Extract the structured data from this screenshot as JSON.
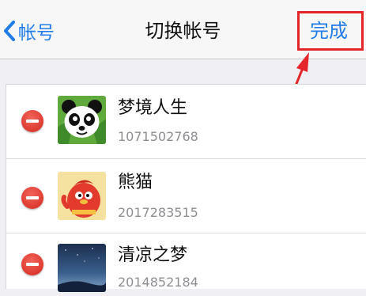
{
  "navbar": {
    "back_label": "帐号",
    "title": "切换帐号",
    "done_label": "完成"
  },
  "accounts": [
    {
      "name": "梦境人生",
      "id": "1071502768",
      "avatar": "panda-avatar"
    },
    {
      "name": "熊猫",
      "id": "2017283515",
      "avatar": "red-mascot-avatar"
    },
    {
      "name": "清凉之梦",
      "id": "2014852184",
      "avatar": "night-sky-avatar"
    }
  ],
  "colors": {
    "accent": "#1f7ce8",
    "delete": "#dd3a30",
    "annotation": "#e4262a"
  }
}
